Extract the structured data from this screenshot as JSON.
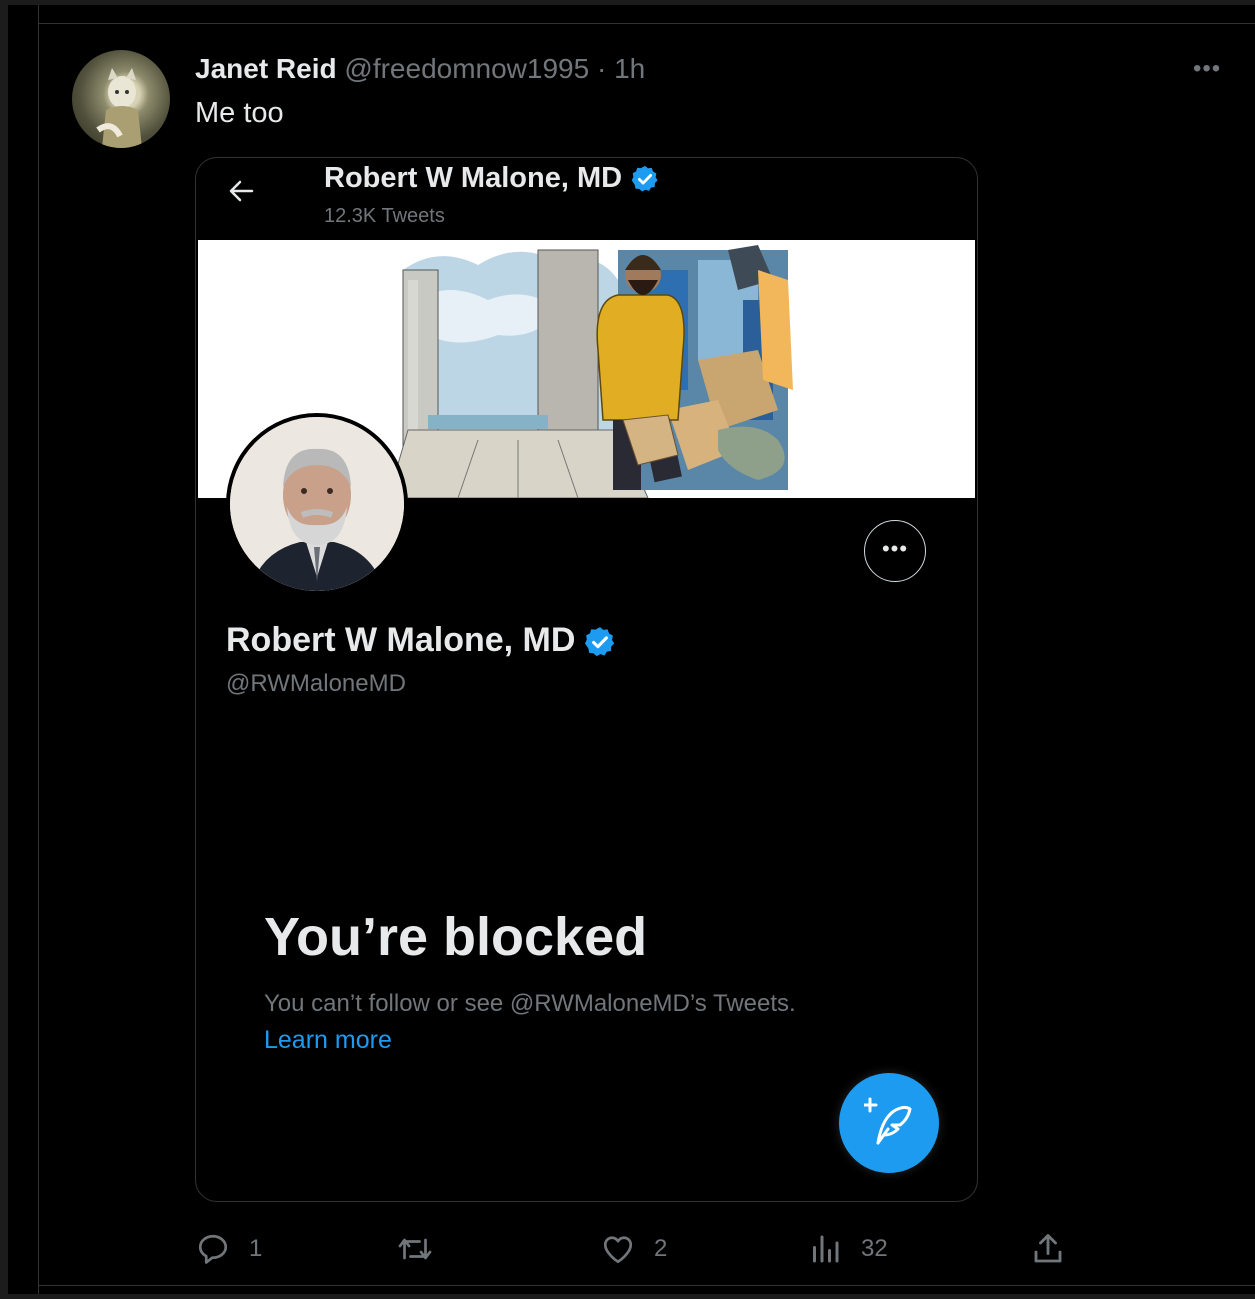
{
  "tweet": {
    "author_name": "Janet Reid",
    "author_handle": "@freedomnow1995",
    "separator": "·",
    "time": "1h",
    "text": "Me too",
    "more_icon": "more-horizontal-icon"
  },
  "embedded_screenshot": {
    "header_title": "Robert W Malone, MD",
    "tweet_count": "12.3K Tweets",
    "profile_name": "Robert W Malone, MD",
    "profile_handle": "@RWMaloneMD",
    "blocked_title": "You’re blocked",
    "blocked_description": "You can’t follow or see @RWMaloneMD’s Tweets.",
    "learn_more": "Learn more",
    "menu_label": "•••",
    "verified_color": "#1d9bf0"
  },
  "actions": {
    "replies": "1",
    "retweets": "",
    "likes": "2",
    "views": "32"
  },
  "colors": {
    "background": "#000000",
    "accent": "#1d9bf0",
    "muted_text": "#71767b"
  }
}
